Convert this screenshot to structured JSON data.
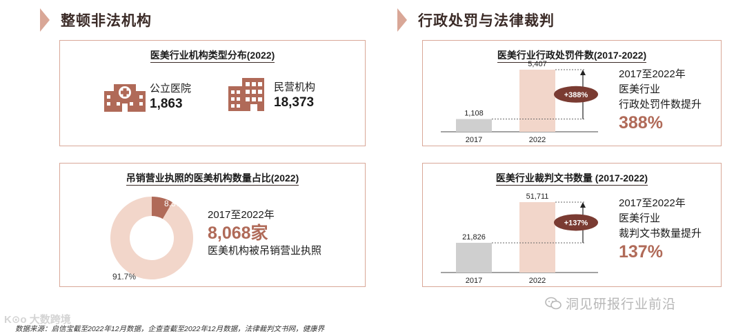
{
  "left_section": {
    "title": "整顿非法机构"
  },
  "right_section": {
    "title": "行政处罚与法律裁判"
  },
  "institutions": {
    "title": "医美行业机构类型分布(2022)",
    "items": [
      {
        "label": "公立医院",
        "value": "1,863",
        "icon": "hospital-icon"
      },
      {
        "label": "民营机构",
        "value": "18,373",
        "icon": "building-icon"
      }
    ]
  },
  "revoked": {
    "title": "吊销营业执照的医美机构数量占比(2022)",
    "desc_line1": "2017至2022年",
    "desc_value": "8,068家",
    "desc_line3": "医美机构被吊销营业执照"
  },
  "penalties": {
    "title": "医美行业行政处罚件数(2017-2022)",
    "desc_line1": "2017至2022年",
    "desc_line2": "医美行业",
    "desc_line3": "行政处罚件数提升",
    "growth_value": "388%",
    "badge": "+388%"
  },
  "judgments": {
    "title": "医美行业裁判文书数量 (2017-2022)",
    "desc_line1": "2017至2022年",
    "desc_line2": "医美行业",
    "desc_line3": "裁判文书数量提升",
    "growth_value": "137%",
    "badge": "+137%"
  },
  "watermark": "洞见研报行业前沿",
  "logo_text": "K⊙o 大数跨境",
  "source": "数据来源：启信宝截至2022年12月数据，企查查截至2022年12月数据，法律裁判文书网，健康界",
  "colors": {
    "accent": "#b06a58",
    "highlight": "#f2d6ca",
    "gray": "#cfcfcf",
    "border": "#d9a797",
    "pill": "#7a3b32"
  },
  "chart_data": [
    {
      "type": "pie",
      "title": "吊销营业执照的医美机构数量占比(2022)",
      "labels": [
        "8.3%",
        "91.7%"
      ],
      "values": [
        8.3,
        91.7
      ]
    },
    {
      "type": "bar",
      "title": "医美行业行政处罚件数(2017-2022)",
      "categories": [
        "2017",
        "2022"
      ],
      "values": [
        1108,
        5407
      ],
      "value_labels": [
        "1,108",
        "5,407"
      ]
    },
    {
      "type": "bar",
      "title": "医美行业裁判文书数量 (2017-2022)",
      "categories": [
        "2017",
        "2022"
      ],
      "values": [
        21826,
        51711
      ],
      "value_labels": [
        "21,826",
        "51,711"
      ]
    }
  ]
}
